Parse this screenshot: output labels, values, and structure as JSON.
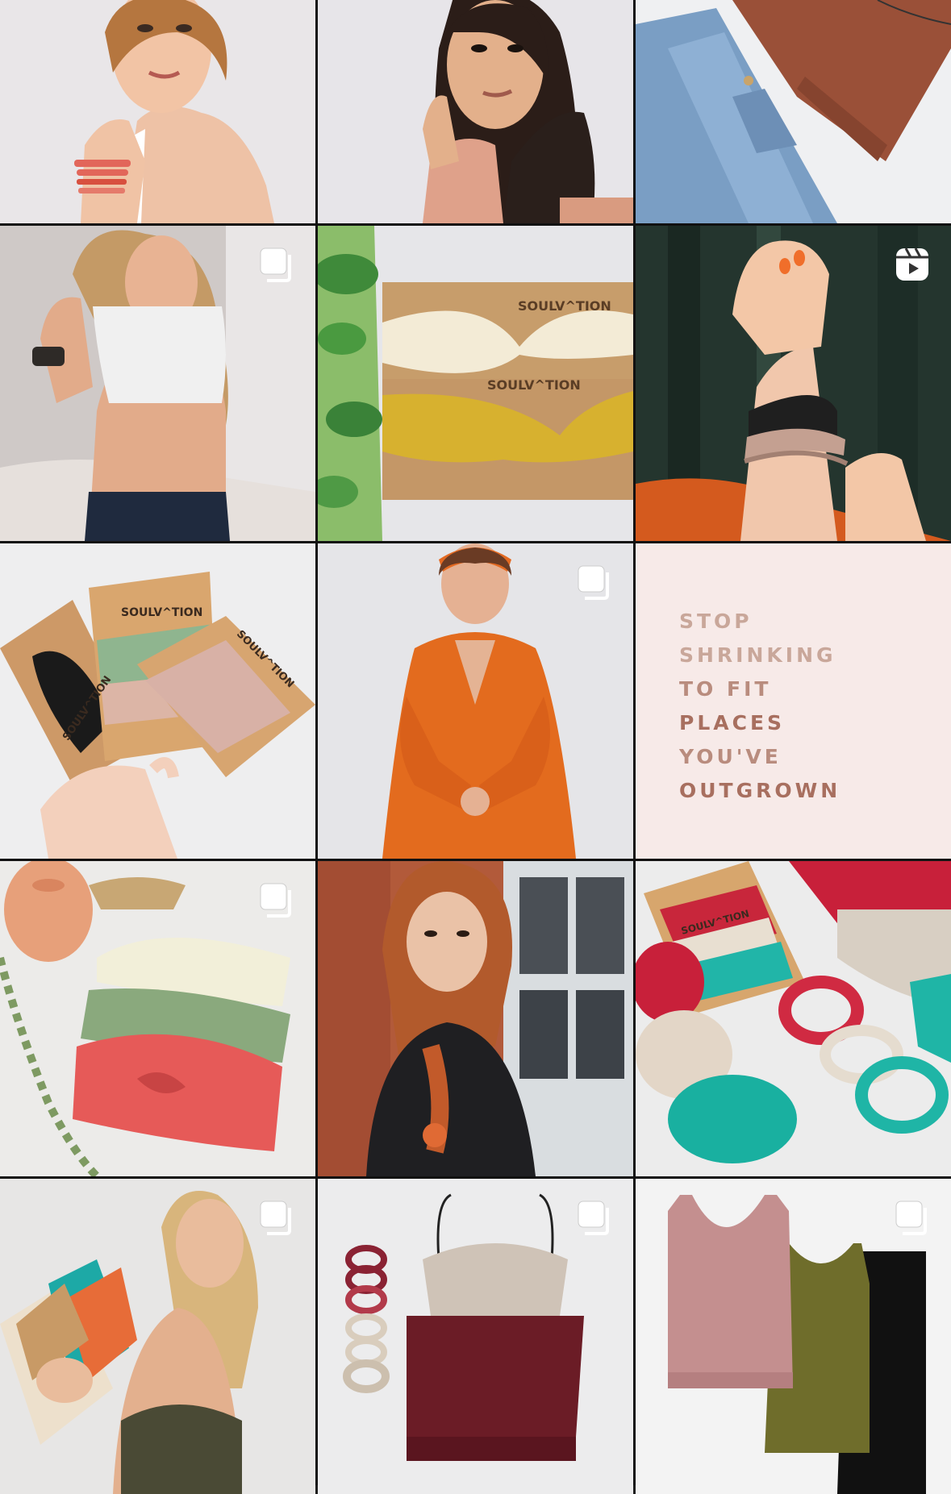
{
  "grid": {
    "tiles": [
      {
        "id": "t1",
        "alt": "woman with bracelets",
        "badge": null
      },
      {
        "id": "t2",
        "alt": "woman in knit sweater",
        "badge": null
      },
      {
        "id": "t3",
        "alt": "jeans and brown top",
        "badge": null
      },
      {
        "id": "t4",
        "alt": "woman in white crop top",
        "badge": "carousel"
      },
      {
        "id": "t5",
        "alt": "twist headbands",
        "badge": null
      },
      {
        "id": "t6",
        "alt": "hair tie bracelets",
        "badge": "reel"
      },
      {
        "id": "t7",
        "alt": "hair tie packs",
        "badge": null
      },
      {
        "id": "t8",
        "alt": "woman in orange dress",
        "badge": "carousel"
      },
      {
        "id": "t9",
        "alt": "quote",
        "badge": null
      },
      {
        "id": "t10",
        "alt": "knotted headbands",
        "badge": "carousel"
      },
      {
        "id": "t11",
        "alt": "woman with braid",
        "badge": null
      },
      {
        "id": "t12",
        "alt": "scrunchies",
        "badge": null
      },
      {
        "id": "t13",
        "alt": "woman holding headbands",
        "badge": "carousel"
      },
      {
        "id": "t14",
        "alt": "bralette tops",
        "badge": "carousel"
      },
      {
        "id": "t15",
        "alt": "tank tops",
        "badge": "carousel"
      }
    ]
  },
  "brand": {
    "package_label": "SOULV^TION",
    "package_label_2": "SOULV^TION",
    "package_label_3": "SOULV^TION",
    "package_label_4": "SOULV^TION",
    "package_label_5": "SOULV^TION",
    "package_label_6": "SOULV^TION",
    "package_label_7": "SOULV^TION"
  },
  "quote": {
    "lines": [
      "STOP",
      "SHRINKING",
      "TO FIT",
      "PLACES",
      "YOU'VE",
      "OUTGROWN"
    ],
    "colors": [
      "#c9a79a",
      "#c9a79a",
      "#b98c7e",
      "#a86f5f",
      "#b98c7e",
      "#a86f5f"
    ],
    "background": "#f7eae8"
  },
  "icons": {
    "carousel": "carousel-icon",
    "reel": "reel-icon"
  }
}
